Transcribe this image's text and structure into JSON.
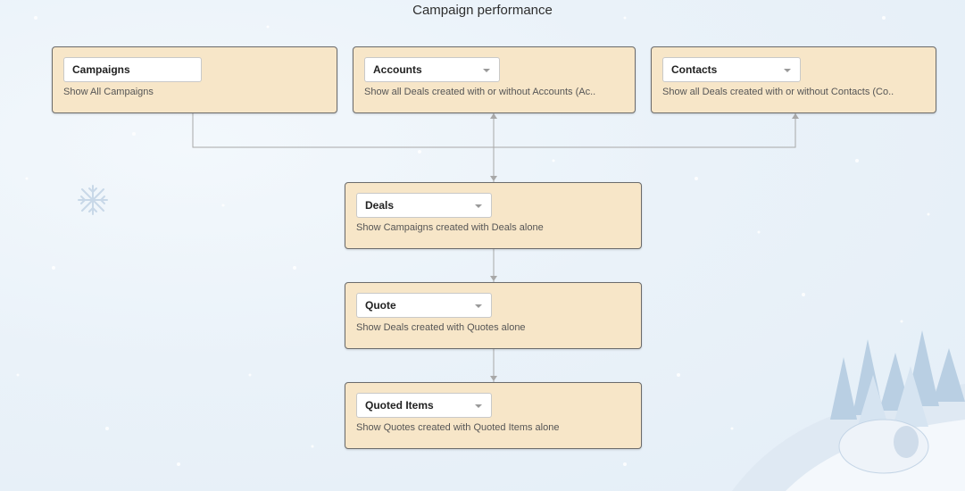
{
  "title": "Campaign performance",
  "modules": {
    "campaigns": {
      "name": "Campaigns",
      "description": "Show All Campaigns"
    },
    "accounts": {
      "name": "Accounts",
      "description": "Show all Deals created with or without Accounts (Ac.."
    },
    "contacts": {
      "name": "Contacts",
      "description": "Show all Deals created with or without Contacts (Co.."
    },
    "deals": {
      "name": "Deals",
      "description": "Show Campaigns created with Deals alone"
    },
    "quote": {
      "name": "Quote",
      "description": "Show Deals created with Quotes alone"
    },
    "quoted_items": {
      "name": "Quoted Items",
      "description": "Show Quotes created with Quoted Items alone"
    }
  },
  "colors": {
    "box_fill": "#f7e6c8",
    "box_border": "#6b6b6b",
    "connector": "#a8a8a8",
    "background": "#eaf2f9"
  },
  "icons": {
    "dropdown": "chevron-down-icon",
    "decoration": "snowflake-icon"
  }
}
